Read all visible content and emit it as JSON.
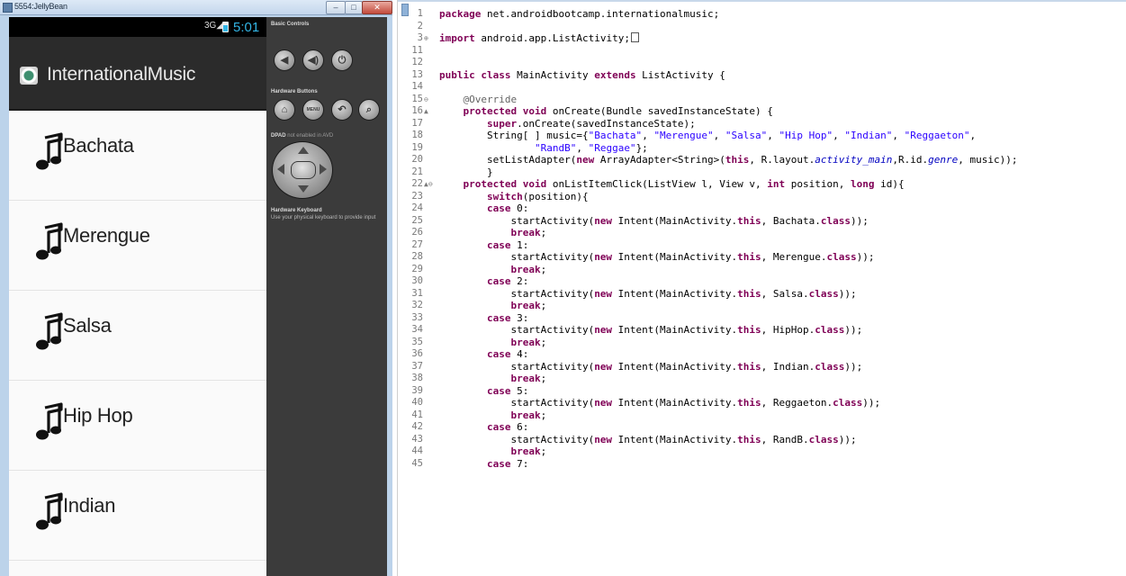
{
  "emulator": {
    "window_title": "5554:JellyBean",
    "status": {
      "network": "3G",
      "time": "5:01"
    },
    "app_title": "InternationalMusic",
    "list_items": [
      "Bachata",
      "Merengue",
      "Salsa",
      "Hip Hop",
      "Indian"
    ],
    "controls": {
      "basic_controls_label": "Basic Controls",
      "hardware_buttons_label": "Hardware Buttons",
      "menu_label": "MENU",
      "dpad_label": "DPAD",
      "dpad_note": "not enabled in AVD",
      "keyboard_title": "Hardware Keyboard",
      "keyboard_note": "Use your physical keyboard to provide input"
    }
  },
  "code_lines": [
    {
      "n": "1",
      "tokens": [
        [
          "k",
          "package"
        ],
        [
          "t",
          " net.androidbootcamp.internationalmusic;"
        ]
      ]
    },
    {
      "n": "2",
      "tokens": []
    },
    {
      "n": "3",
      "mark": "⊕",
      "tokens": [
        [
          "k",
          "import"
        ],
        [
          "t",
          " android.app.ListActivity;"
        ],
        [
          "box",
          ""
        ]
      ]
    },
    {
      "n": "11",
      "tokens": []
    },
    {
      "n": "12",
      "tokens": []
    },
    {
      "n": "13",
      "tokens": [
        [
          "k",
          "public class"
        ],
        [
          "t",
          " MainActivity "
        ],
        [
          "k",
          "extends"
        ],
        [
          "t",
          " ListActivity {"
        ]
      ]
    },
    {
      "n": "14",
      "tokens": []
    },
    {
      "n": "15",
      "mark": "⊖",
      "tokens": [
        [
          "t",
          "    "
        ],
        [
          "a",
          "@Override"
        ]
      ]
    },
    {
      "n": "16",
      "mark": "▲",
      "tokens": [
        [
          "t",
          "    "
        ],
        [
          "k",
          "protected void"
        ],
        [
          "t",
          " onCreate(Bundle savedInstanceState) {"
        ]
      ]
    },
    {
      "n": "17",
      "tokens": [
        [
          "t",
          "        "
        ],
        [
          "k",
          "super"
        ],
        [
          "t",
          ".onCreate(savedInstanceState);"
        ]
      ]
    },
    {
      "n": "18",
      "tokens": [
        [
          "t",
          "        String[ ] music={"
        ],
        [
          "s",
          "\"Bachata\""
        ],
        [
          "t",
          ", "
        ],
        [
          "s",
          "\"Merengue\""
        ],
        [
          "t",
          ", "
        ],
        [
          "s",
          "\"Salsa\""
        ],
        [
          "t",
          ", "
        ],
        [
          "s",
          "\"Hip Hop\""
        ],
        [
          "t",
          ", "
        ],
        [
          "s",
          "\"Indian\""
        ],
        [
          "t",
          ", "
        ],
        [
          "s",
          "\"Reggaeton\""
        ],
        [
          "t",
          ","
        ]
      ]
    },
    {
      "n": "19",
      "tokens": [
        [
          "t",
          "                "
        ],
        [
          "s",
          "\"RandB\""
        ],
        [
          "t",
          ", "
        ],
        [
          "s",
          "\"Reggae\""
        ],
        [
          "t",
          "};"
        ]
      ]
    },
    {
      "n": "20",
      "tokens": [
        [
          "t",
          "        setListAdapter("
        ],
        [
          "k",
          "new"
        ],
        [
          "t",
          " ArrayAdapter<String>("
        ],
        [
          "k",
          "this"
        ],
        [
          "t",
          ", R.layout."
        ],
        [
          "f",
          "activity_main"
        ],
        [
          "t",
          ",R.id."
        ],
        [
          "f",
          "genre"
        ],
        [
          "t",
          ", music));"
        ]
      ]
    },
    {
      "n": "21",
      "tokens": [
        [
          "t",
          "        }"
        ]
      ]
    },
    {
      "n": "22",
      "mark": "▲⊖",
      "tokens": [
        [
          "t",
          "    "
        ],
        [
          "k",
          "protected void"
        ],
        [
          "t",
          " onListItemClick(ListView l, View v, "
        ],
        [
          "k",
          "int"
        ],
        [
          "t",
          " position, "
        ],
        [
          "k",
          "long"
        ],
        [
          "t",
          " id){"
        ]
      ]
    },
    {
      "n": "23",
      "tokens": [
        [
          "t",
          "        "
        ],
        [
          "k",
          "switch"
        ],
        [
          "t",
          "(position){"
        ]
      ]
    },
    {
      "n": "24",
      "tokens": [
        [
          "t",
          "        "
        ],
        [
          "k",
          "case"
        ],
        [
          "t",
          " 0:"
        ]
      ]
    },
    {
      "n": "25",
      "tokens": [
        [
          "t",
          "            startActivity("
        ],
        [
          "k",
          "new"
        ],
        [
          "t",
          " Intent(MainActivity."
        ],
        [
          "k",
          "this"
        ],
        [
          "t",
          ", Bachata."
        ],
        [
          "k",
          "class"
        ],
        [
          "t",
          "));"
        ]
      ]
    },
    {
      "n": "26",
      "tokens": [
        [
          "t",
          "            "
        ],
        [
          "k",
          "break"
        ],
        [
          "t",
          ";"
        ]
      ]
    },
    {
      "n": "27",
      "tokens": [
        [
          "t",
          "        "
        ],
        [
          "k",
          "case"
        ],
        [
          "t",
          " 1:"
        ]
      ]
    },
    {
      "n": "28",
      "tokens": [
        [
          "t",
          "            startActivity("
        ],
        [
          "k",
          "new"
        ],
        [
          "t",
          " Intent(MainActivity."
        ],
        [
          "k",
          "this"
        ],
        [
          "t",
          ", Merengue."
        ],
        [
          "k",
          "class"
        ],
        [
          "t",
          "));"
        ]
      ]
    },
    {
      "n": "29",
      "tokens": [
        [
          "t",
          "            "
        ],
        [
          "k",
          "break"
        ],
        [
          "t",
          ";"
        ]
      ]
    },
    {
      "n": "30",
      "tokens": [
        [
          "t",
          "        "
        ],
        [
          "k",
          "case"
        ],
        [
          "t",
          " 2:"
        ]
      ]
    },
    {
      "n": "31",
      "tokens": [
        [
          "t",
          "            startActivity("
        ],
        [
          "k",
          "new"
        ],
        [
          "t",
          " Intent(MainActivity."
        ],
        [
          "k",
          "this"
        ],
        [
          "t",
          ", Salsa."
        ],
        [
          "k",
          "class"
        ],
        [
          "t",
          "));"
        ]
      ]
    },
    {
      "n": "32",
      "tokens": [
        [
          "t",
          "            "
        ],
        [
          "k",
          "break"
        ],
        [
          "t",
          ";"
        ]
      ]
    },
    {
      "n": "33",
      "tokens": [
        [
          "t",
          "        "
        ],
        [
          "k",
          "case"
        ],
        [
          "t",
          " 3:"
        ]
      ]
    },
    {
      "n": "34",
      "tokens": [
        [
          "t",
          "            startActivity("
        ],
        [
          "k",
          "new"
        ],
        [
          "t",
          " Intent(MainActivity."
        ],
        [
          "k",
          "this"
        ],
        [
          "t",
          ", HipHop."
        ],
        [
          "k",
          "class"
        ],
        [
          "t",
          "));"
        ]
      ]
    },
    {
      "n": "35",
      "tokens": [
        [
          "t",
          "            "
        ],
        [
          "k",
          "break"
        ],
        [
          "t",
          ";"
        ]
      ]
    },
    {
      "n": "36",
      "tokens": [
        [
          "t",
          "        "
        ],
        [
          "k",
          "case"
        ],
        [
          "t",
          " 4:"
        ]
      ]
    },
    {
      "n": "37",
      "tokens": [
        [
          "t",
          "            startActivity("
        ],
        [
          "k",
          "new"
        ],
        [
          "t",
          " Intent(MainActivity."
        ],
        [
          "k",
          "this"
        ],
        [
          "t",
          ", Indian."
        ],
        [
          "k",
          "class"
        ],
        [
          "t",
          "));"
        ]
      ]
    },
    {
      "n": "38",
      "tokens": [
        [
          "t",
          "            "
        ],
        [
          "k",
          "break"
        ],
        [
          "t",
          ";"
        ]
      ]
    },
    {
      "n": "39",
      "tokens": [
        [
          "t",
          "        "
        ],
        [
          "k",
          "case"
        ],
        [
          "t",
          " 5:"
        ]
      ]
    },
    {
      "n": "40",
      "tokens": [
        [
          "t",
          "            startActivity("
        ],
        [
          "k",
          "new"
        ],
        [
          "t",
          " Intent(MainActivity."
        ],
        [
          "k",
          "this"
        ],
        [
          "t",
          ", Reggaeton."
        ],
        [
          "k",
          "class"
        ],
        [
          "t",
          "));"
        ]
      ]
    },
    {
      "n": "41",
      "tokens": [
        [
          "t",
          "            "
        ],
        [
          "k",
          "break"
        ],
        [
          "t",
          ";"
        ]
      ]
    },
    {
      "n": "42",
      "tokens": [
        [
          "t",
          "        "
        ],
        [
          "k",
          "case"
        ],
        [
          "t",
          " 6:"
        ]
      ]
    },
    {
      "n": "43",
      "tokens": [
        [
          "t",
          "            startActivity("
        ],
        [
          "k",
          "new"
        ],
        [
          "t",
          " Intent(MainActivity."
        ],
        [
          "k",
          "this"
        ],
        [
          "t",
          ", RandB."
        ],
        [
          "k",
          "class"
        ],
        [
          "t",
          "));"
        ]
      ]
    },
    {
      "n": "44",
      "tokens": [
        [
          "t",
          "            "
        ],
        [
          "k",
          "break"
        ],
        [
          "t",
          ";"
        ]
      ]
    },
    {
      "n": "45",
      "tokens": [
        [
          "t",
          "        "
        ],
        [
          "k",
          "case"
        ],
        [
          "t",
          " 7:"
        ]
      ]
    }
  ],
  "colors": {
    "keyword": "#7f0055",
    "string": "#2a00ff",
    "annotation": "#646464",
    "field": "#0000c0",
    "holo_blue": "#33b5e5"
  }
}
